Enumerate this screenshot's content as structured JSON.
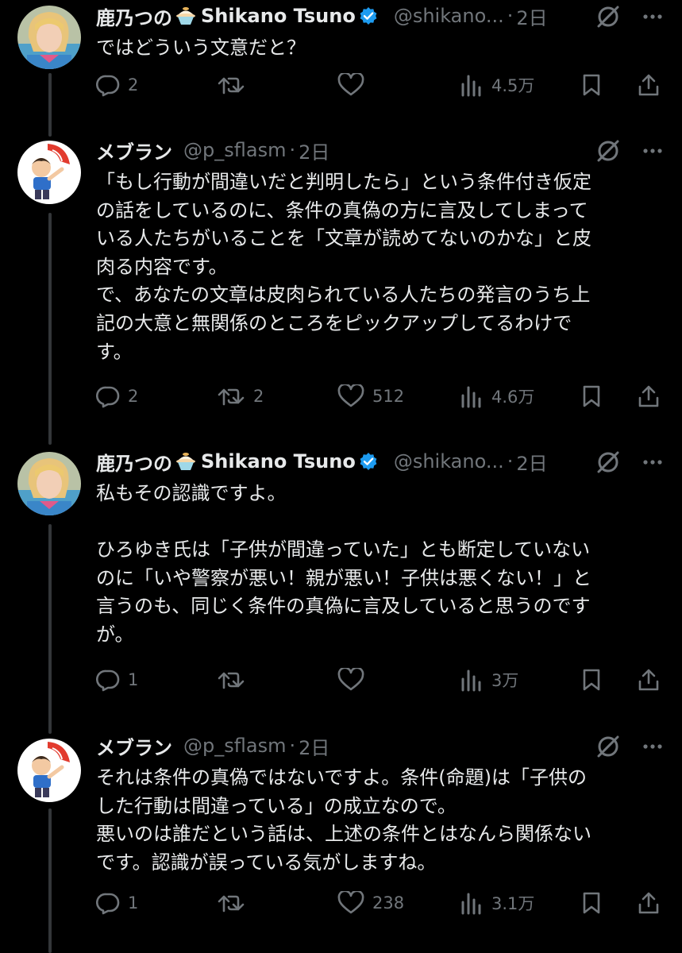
{
  "colors": {
    "background": "#000000",
    "text": "#e7e9ea",
    "secondary": "#71767b",
    "verified": "#1d9bf0",
    "thread_line": "#333639"
  },
  "tweets": [
    {
      "author_name": "鹿乃つの",
      "author_name_latin": "Shikano Tsuno",
      "emoji": "shaved-ice-icon",
      "verified": true,
      "handle": "@shikano...",
      "dot": "·",
      "time": "2日",
      "text": "ではどういう文意だと？",
      "replies": "2",
      "retweets": "",
      "likes": "",
      "views": "4.5万"
    },
    {
      "author_name": "メブラン",
      "verified": false,
      "handle": "@p_sflasm",
      "dot": "·",
      "time": "2日",
      "text": "「もし行動が間違いだと判明したら」という条件付き仮定\nの話をしているのに、条件の真偽の方に言及してしまって\nいる人たちがいることを「文章が読めてないのかな」と皮\n肉る内容です。\nで、あなたの文章は皮肉られている人たちの発言のうち上\n記の大意と無関係のところをピックアップしてるわけで\nす。",
      "replies": "2",
      "retweets": "2",
      "likes": "512",
      "views": "4.6万"
    },
    {
      "author_name": "鹿乃つの",
      "author_name_latin": "Shikano Tsuno",
      "emoji": "shaved-ice-icon",
      "verified": true,
      "handle": "@shikano...",
      "dot": "·",
      "time": "2日",
      "text": "私もその認識ですよ。\n\nひろゆき氏は「子供が間違っていた」とも断定していない\nのに「いや警察が悪い！親が悪い！子供は悪くない！」と\n言うのも、同じく条件の真偽に言及していると思うのです\nが。",
      "replies": "1",
      "retweets": "",
      "likes": "",
      "views": "3万"
    },
    {
      "author_name": "メブラン",
      "verified": false,
      "handle": "@p_sflasm",
      "dot": "·",
      "time": "2日",
      "text": "それは条件の真偽ではないですよ。条件(命題)は「子供の\nした行動は間違っている」の成立なので。\n悪いのは誰だという話は、上述の条件とはなんら関係ない\nです。認識が誤っている気がしますね。",
      "replies": "1",
      "retweets": "",
      "likes": "238",
      "views": "3.1万"
    }
  ]
}
